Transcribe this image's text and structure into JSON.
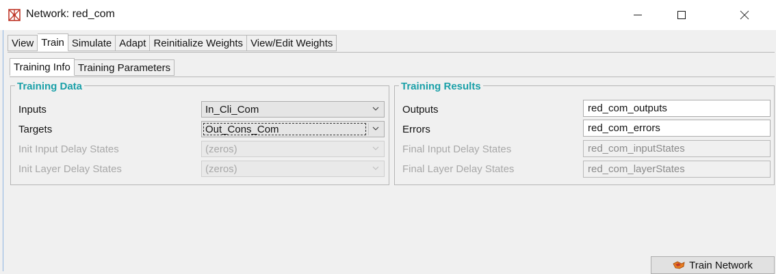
{
  "window": {
    "title": "Network: red_com",
    "controls": [
      "minimize",
      "maximize",
      "close"
    ]
  },
  "main_tabs": [
    {
      "label": "View"
    },
    {
      "label": "Train",
      "active": true
    },
    {
      "label": "Simulate"
    },
    {
      "label": "Adapt"
    },
    {
      "label": "Reinitialize Weights"
    },
    {
      "label": "View/Edit Weights"
    }
  ],
  "sub_tabs": [
    {
      "label": "Training Info",
      "active": true
    },
    {
      "label": "Training Parameters"
    }
  ],
  "training_data": {
    "title": "Training Data",
    "inputs": {
      "label": "Inputs",
      "value": "In_Cli_Com"
    },
    "targets": {
      "label": "Targets",
      "value": "Out_Cons_Com"
    },
    "init_input_delay": {
      "label": "Init Input Delay States",
      "value": "(zeros)"
    },
    "init_layer_delay": {
      "label": "Init Layer Delay States",
      "value": "(zeros)"
    }
  },
  "training_results": {
    "title": "Training Results",
    "outputs": {
      "label": "Outputs",
      "value": "red_com_outputs"
    },
    "errors": {
      "label": "Errors",
      "value": "red_com_errors"
    },
    "final_input_delay": {
      "label": "Final Input Delay States",
      "value": "red_com_inputStates"
    },
    "final_layer_delay": {
      "label": "Final Layer Delay States",
      "value": "red_com_layerStates"
    }
  },
  "actions": {
    "train_network": "Train Network"
  },
  "colors": {
    "section_title": "#1aa0a8",
    "disabled_text": "#a8a8a8"
  },
  "icons": [
    "network-app-icon",
    "minimize-icon",
    "maximize-icon",
    "close-icon",
    "chevron-down-icon",
    "train-network-icon"
  ]
}
